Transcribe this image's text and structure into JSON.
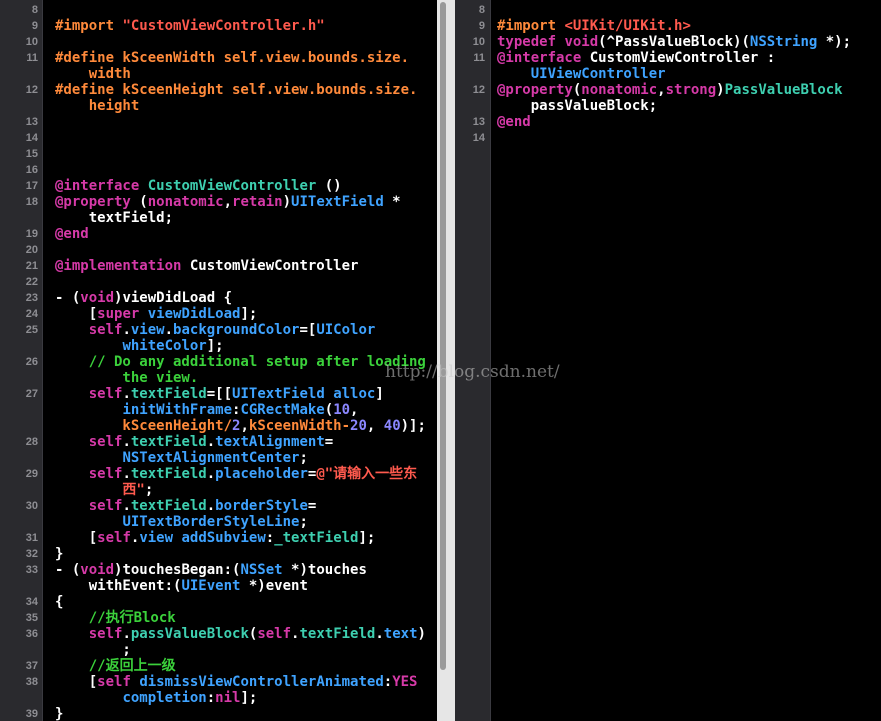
{
  "colors": {
    "text": "#ffffff",
    "keyword": "#d63aa8",
    "string": "#ff5a4e",
    "preprocessor": "#ff8a3b",
    "class": "#3fa3ff",
    "project_type": "#3ecfb0",
    "comment": "#3bd13b",
    "number": "#8b87ff",
    "gutter_number": "#8e8e93"
  },
  "watermark": "http://blog.csdn.net/",
  "left_editor": {
    "lines": [
      {
        "n": "8",
        "parts": []
      },
      {
        "n": "9",
        "parts": [
          {
            "t": "#import ",
            "c": "preprocessor"
          },
          {
            "t": "\"CustomViewController.h\"",
            "c": "string"
          }
        ]
      },
      {
        "n": "10",
        "parts": []
      },
      {
        "n": "11",
        "parts": [
          {
            "t": "#define kSceenWidth self.view.bounds.size.",
            "c": "preprocessor"
          }
        ]
      },
      {
        "n": "",
        "parts": [
          {
            "t": "    width",
            "c": "preprocessor"
          }
        ]
      },
      {
        "n": "12",
        "parts": [
          {
            "t": "#define kSceenHeight self.view.bounds.size.",
            "c": "preprocessor"
          }
        ]
      },
      {
        "n": "",
        "parts": [
          {
            "t": "    height",
            "c": "preprocessor"
          }
        ]
      },
      {
        "n": "13",
        "parts": []
      },
      {
        "n": "14",
        "parts": []
      },
      {
        "n": "15",
        "parts": []
      },
      {
        "n": "16",
        "parts": []
      },
      {
        "n": "17",
        "parts": [
          {
            "t": "@interface",
            "c": "keyword"
          },
          {
            "t": " ",
            "c": "text"
          },
          {
            "t": "CustomViewController",
            "c": "project_type"
          },
          {
            "t": " ()",
            "c": "text"
          }
        ]
      },
      {
        "n": "18",
        "parts": [
          {
            "t": "@property",
            "c": "keyword"
          },
          {
            "t": " (",
            "c": "text"
          },
          {
            "t": "nonatomic",
            "c": "keyword"
          },
          {
            "t": ",",
            "c": "text"
          },
          {
            "t": "retain",
            "c": "keyword"
          },
          {
            "t": ")",
            "c": "text"
          },
          {
            "t": "UITextField",
            "c": "class"
          },
          {
            "t": " *",
            "c": "text"
          }
        ]
      },
      {
        "n": "",
        "parts": [
          {
            "t": "    textField;",
            "c": "text"
          }
        ]
      },
      {
        "n": "19",
        "parts": [
          {
            "t": "@end",
            "c": "keyword"
          }
        ]
      },
      {
        "n": "20",
        "parts": []
      },
      {
        "n": "21",
        "parts": [
          {
            "t": "@implementation",
            "c": "keyword"
          },
          {
            "t": " CustomViewController",
            "c": "text"
          }
        ]
      },
      {
        "n": "22",
        "parts": []
      },
      {
        "n": "23",
        "parts": [
          {
            "t": "- (",
            "c": "text"
          },
          {
            "t": "void",
            "c": "keyword"
          },
          {
            "t": ")viewDidLoad {",
            "c": "text"
          }
        ]
      },
      {
        "n": "24",
        "parts": [
          {
            "t": "    [",
            "c": "text"
          },
          {
            "t": "super",
            "c": "keyword"
          },
          {
            "t": " ",
            "c": "text"
          },
          {
            "t": "viewDidLoad",
            "c": "class"
          },
          {
            "t": "];",
            "c": "text"
          }
        ]
      },
      {
        "n": "25",
        "parts": [
          {
            "t": "    ",
            "c": "text"
          },
          {
            "t": "self",
            "c": "keyword"
          },
          {
            "t": ".",
            "c": "text"
          },
          {
            "t": "view",
            "c": "class"
          },
          {
            "t": ".",
            "c": "text"
          },
          {
            "t": "backgroundColor",
            "c": "class"
          },
          {
            "t": "=[",
            "c": "text"
          },
          {
            "t": "UIColor",
            "c": "class"
          }
        ]
      },
      {
        "n": "",
        "parts": [
          {
            "t": "        ",
            "c": "text"
          },
          {
            "t": "whiteColor",
            "c": "class"
          },
          {
            "t": "];",
            "c": "text"
          }
        ]
      },
      {
        "n": "26",
        "parts": [
          {
            "t": "    // Do any additional setup after loading",
            "c": "comment"
          }
        ]
      },
      {
        "n": "",
        "parts": [
          {
            "t": "        the view.",
            "c": "comment"
          }
        ]
      },
      {
        "n": "27",
        "parts": [
          {
            "t": "    ",
            "c": "text"
          },
          {
            "t": "self",
            "c": "keyword"
          },
          {
            "t": ".",
            "c": "text"
          },
          {
            "t": "textField",
            "c": "project_type"
          },
          {
            "t": "=[[",
            "c": "text"
          },
          {
            "t": "UITextField",
            "c": "class"
          },
          {
            "t": " ",
            "c": "text"
          },
          {
            "t": "alloc",
            "c": "class"
          },
          {
            "t": "]",
            "c": "text"
          }
        ]
      },
      {
        "n": "",
        "parts": [
          {
            "t": "        ",
            "c": "text"
          },
          {
            "t": "initWithFrame",
            "c": "class"
          },
          {
            "t": ":",
            "c": "text"
          },
          {
            "t": "CGRectMake",
            "c": "class"
          },
          {
            "t": "(",
            "c": "text"
          },
          {
            "t": "10",
            "c": "number"
          },
          {
            "t": ",",
            "c": "text"
          }
        ]
      },
      {
        "n": "",
        "parts": [
          {
            "t": "        kSceenHeight/",
            "c": "preprocessor"
          },
          {
            "t": "2",
            "c": "number"
          },
          {
            "t": ",",
            "c": "text"
          },
          {
            "t": "kSceenWidth-",
            "c": "preprocessor"
          },
          {
            "t": "20",
            "c": "number"
          },
          {
            "t": ", ",
            "c": "text"
          },
          {
            "t": "40",
            "c": "number"
          },
          {
            "t": ")];",
            "c": "text"
          }
        ]
      },
      {
        "n": "28",
        "parts": [
          {
            "t": "    ",
            "c": "text"
          },
          {
            "t": "self",
            "c": "keyword"
          },
          {
            "t": ".",
            "c": "text"
          },
          {
            "t": "textField",
            "c": "project_type"
          },
          {
            "t": ".",
            "c": "text"
          },
          {
            "t": "textAlignment",
            "c": "class"
          },
          {
            "t": "=",
            "c": "text"
          }
        ]
      },
      {
        "n": "",
        "parts": [
          {
            "t": "        ",
            "c": "text"
          },
          {
            "t": "NSTextAlignmentCenter",
            "c": "class"
          },
          {
            "t": ";",
            "c": "text"
          }
        ]
      },
      {
        "n": "29",
        "parts": [
          {
            "t": "    ",
            "c": "text"
          },
          {
            "t": "self",
            "c": "keyword"
          },
          {
            "t": ".",
            "c": "text"
          },
          {
            "t": "textField",
            "c": "project_type"
          },
          {
            "t": ".",
            "c": "text"
          },
          {
            "t": "placeholder",
            "c": "class"
          },
          {
            "t": "=",
            "c": "text"
          },
          {
            "t": "@\"请输入一些东",
            "c": "string"
          }
        ]
      },
      {
        "n": "",
        "parts": [
          {
            "t": "        西\"",
            "c": "string"
          },
          {
            "t": ";",
            "c": "text"
          }
        ]
      },
      {
        "n": "30",
        "parts": [
          {
            "t": "    ",
            "c": "text"
          },
          {
            "t": "self",
            "c": "keyword"
          },
          {
            "t": ".",
            "c": "text"
          },
          {
            "t": "textField",
            "c": "project_type"
          },
          {
            "t": ".",
            "c": "text"
          },
          {
            "t": "borderStyle",
            "c": "class"
          },
          {
            "t": "=",
            "c": "text"
          }
        ]
      },
      {
        "n": "",
        "parts": [
          {
            "t": "        ",
            "c": "text"
          },
          {
            "t": "UITextBorderStyleLine",
            "c": "class"
          },
          {
            "t": ";",
            "c": "text"
          }
        ]
      },
      {
        "n": "31",
        "parts": [
          {
            "t": "    [",
            "c": "text"
          },
          {
            "t": "self",
            "c": "keyword"
          },
          {
            "t": ".",
            "c": "text"
          },
          {
            "t": "view",
            "c": "class"
          },
          {
            "t": " ",
            "c": "text"
          },
          {
            "t": "addSubview",
            "c": "class"
          },
          {
            "t": ":",
            "c": "text"
          },
          {
            "t": "_textField",
            "c": "project_type"
          },
          {
            "t": "];",
            "c": "text"
          }
        ]
      },
      {
        "n": "32",
        "parts": [
          {
            "t": "}",
            "c": "text"
          }
        ]
      },
      {
        "n": "33",
        "parts": [
          {
            "t": "- (",
            "c": "text"
          },
          {
            "t": "void",
            "c": "keyword"
          },
          {
            "t": ")touchesBegan:(",
            "c": "text"
          },
          {
            "t": "NSSet",
            "c": "class"
          },
          {
            "t": " *)touches",
            "c": "text"
          }
        ]
      },
      {
        "n": "",
        "parts": [
          {
            "t": "    withEvent:(",
            "c": "text"
          },
          {
            "t": "UIEvent",
            "c": "class"
          },
          {
            "t": " *)event",
            "c": "text"
          }
        ]
      },
      {
        "n": "34",
        "parts": [
          {
            "t": "{",
            "c": "text"
          }
        ]
      },
      {
        "n": "35",
        "parts": [
          {
            "t": "    //执行Block",
            "c": "comment"
          }
        ]
      },
      {
        "n": "36",
        "parts": [
          {
            "t": "    ",
            "c": "text"
          },
          {
            "t": "self",
            "c": "keyword"
          },
          {
            "t": ".",
            "c": "text"
          },
          {
            "t": "passValueBlock",
            "c": "project_type"
          },
          {
            "t": "(",
            "c": "text"
          },
          {
            "t": "self",
            "c": "keyword"
          },
          {
            "t": ".",
            "c": "text"
          },
          {
            "t": "textField",
            "c": "project_type"
          },
          {
            "t": ".",
            "c": "text"
          },
          {
            "t": "text",
            "c": "class"
          },
          {
            "t": ")",
            "c": "text"
          }
        ]
      },
      {
        "n": "",
        "parts": [
          {
            "t": "        ;",
            "c": "text"
          }
        ]
      },
      {
        "n": "37",
        "parts": [
          {
            "t": "    //返回上一级",
            "c": "comment"
          }
        ]
      },
      {
        "n": "38",
        "parts": [
          {
            "t": "    [",
            "c": "text"
          },
          {
            "t": "self",
            "c": "keyword"
          },
          {
            "t": " ",
            "c": "text"
          },
          {
            "t": "dismissViewControllerAnimated",
            "c": "class"
          },
          {
            "t": ":",
            "c": "text"
          },
          {
            "t": "YES",
            "c": "keyword"
          }
        ]
      },
      {
        "n": "",
        "parts": [
          {
            "t": "        ",
            "c": "text"
          },
          {
            "t": "completion",
            "c": "class"
          },
          {
            "t": ":",
            "c": "text"
          },
          {
            "t": "nil",
            "c": "keyword"
          },
          {
            "t": "];",
            "c": "text"
          }
        ]
      },
      {
        "n": "39",
        "parts": [
          {
            "t": "}",
            "c": "text"
          }
        ]
      }
    ]
  },
  "right_editor": {
    "lines": [
      {
        "n": "8",
        "parts": []
      },
      {
        "n": "9",
        "parts": [
          {
            "t": "#import ",
            "c": "preprocessor"
          },
          {
            "t": "<UIKit/UIKit.h>",
            "c": "string"
          }
        ]
      },
      {
        "n": "10",
        "parts": [
          {
            "t": "typedef",
            "c": "keyword"
          },
          {
            "t": " ",
            "c": "text"
          },
          {
            "t": "void",
            "c": "keyword"
          },
          {
            "t": "(^PassValueBlock)(",
            "c": "text"
          },
          {
            "t": "NSString",
            "c": "class"
          },
          {
            "t": " *);",
            "c": "text"
          }
        ]
      },
      {
        "n": "11",
        "parts": [
          {
            "t": "@interface",
            "c": "keyword"
          },
          {
            "t": " CustomViewController :",
            "c": "text"
          }
        ]
      },
      {
        "n": "",
        "parts": [
          {
            "t": "    ",
            "c": "text"
          },
          {
            "t": "UIViewController",
            "c": "class"
          }
        ]
      },
      {
        "n": "12",
        "parts": [
          {
            "t": "@property",
            "c": "keyword"
          },
          {
            "t": "(",
            "c": "text"
          },
          {
            "t": "nonatomic",
            "c": "keyword"
          },
          {
            "t": ",",
            "c": "text"
          },
          {
            "t": "strong",
            "c": "keyword"
          },
          {
            "t": ")",
            "c": "text"
          },
          {
            "t": "PassValueBlock",
            "c": "project_type"
          }
        ]
      },
      {
        "n": "",
        "parts": [
          {
            "t": "    passValueBlock;",
            "c": "text"
          }
        ]
      },
      {
        "n": "13",
        "parts": [
          {
            "t": "@end",
            "c": "keyword"
          }
        ]
      },
      {
        "n": "14",
        "parts": []
      }
    ]
  }
}
